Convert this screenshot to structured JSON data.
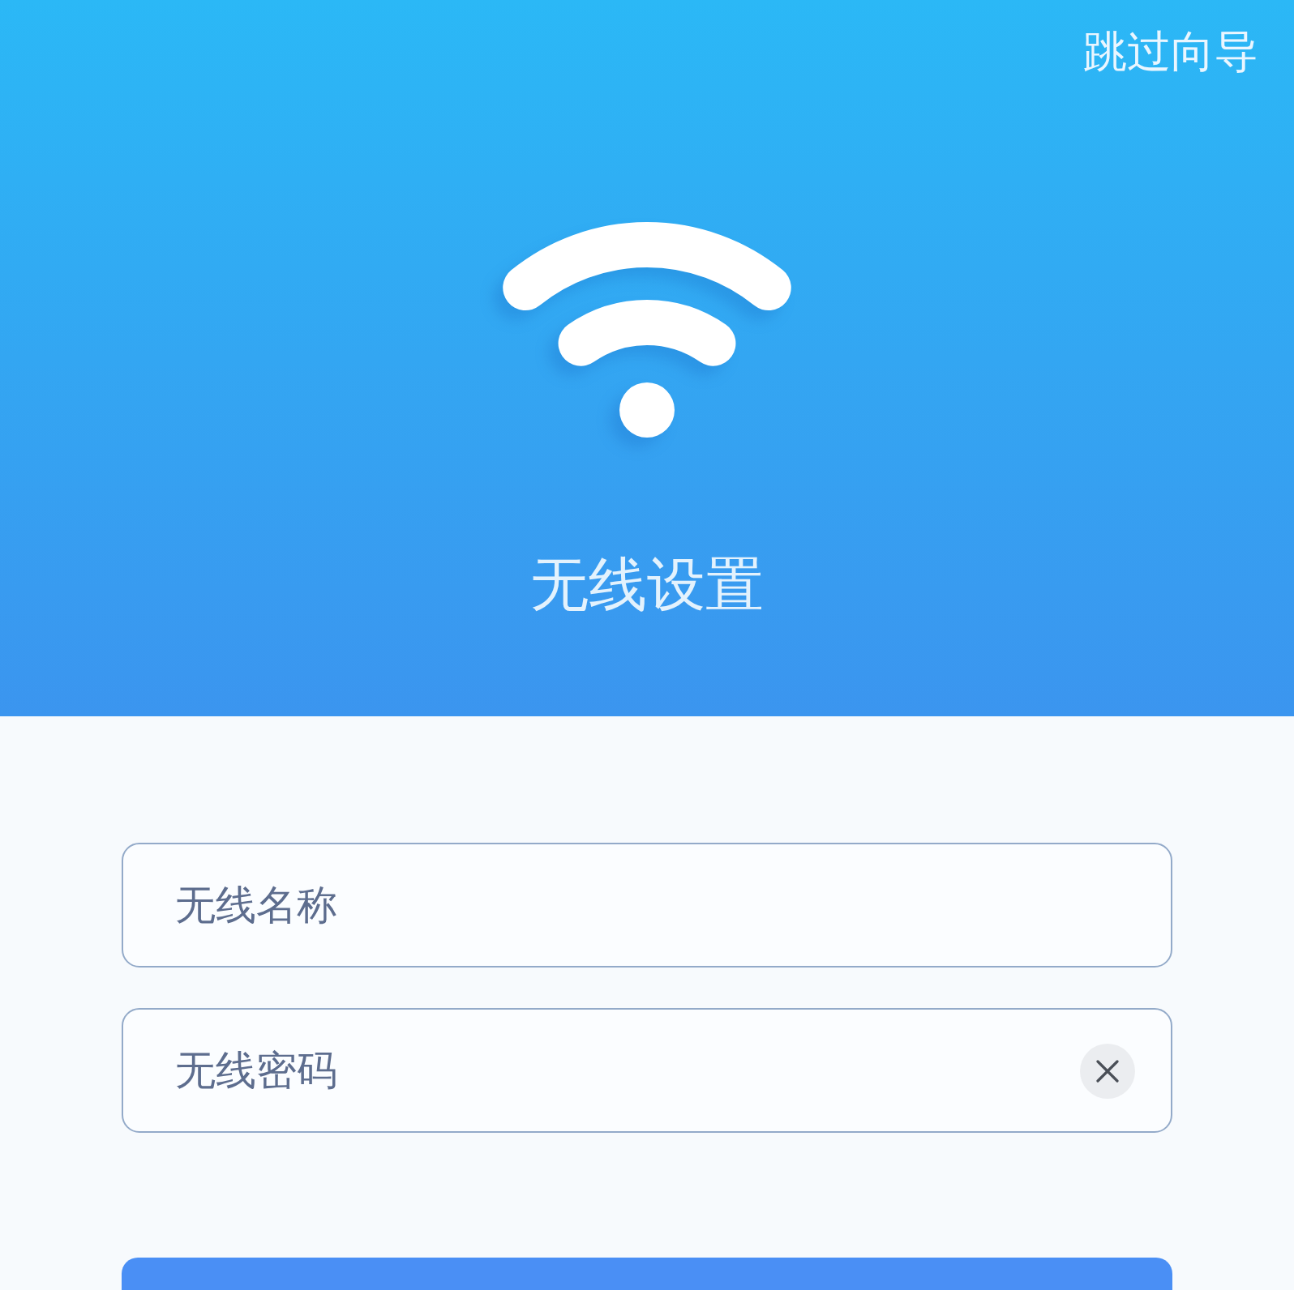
{
  "header": {
    "skip_link": "跳过向导",
    "title": "无线设置"
  },
  "form": {
    "fields": [
      {
        "placeholder": "无线名称",
        "clearable": false
      },
      {
        "placeholder": "无线密码",
        "clearable": true
      }
    ]
  }
}
